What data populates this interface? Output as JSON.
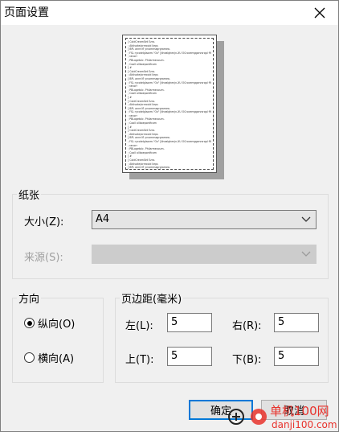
{
  "window": {
    "title": "页面设置"
  },
  "preview": {
    "lines": [
      "[ ColdCreamSet Ezra.",
      "; Aktivate/orrecold lieps",
      "[ BPL anre Ifl yrcommagrgramea.",
      "; FSL rycotelglazzm.\"Ox\" [khealghenjn-XU OCrocemgganrsrqpl ffi",
      "; ranorr",
      "; PBLagetolc. Philarmecoum.",
      "; CoolI ollboepordfcom",
      "[ #",
      "[ ColdCreamSet Ezra.",
      "; Aktivate/orrecold lieps",
      "[ BPL anre Ifl yrcommagrgramea.",
      "; FSL rycotelglazzm.\"Ox\" [khealghenjn-XU OCrocemgganrsrqpl ffi",
      "; ranorr",
      "; PBLagetolc. Philarmecoum.",
      "; CoolI ollboepordfcom",
      "[ #",
      "[ ColdCreamSet Ezra.",
      "; Aktivate/orrecold lieps",
      "[ BPL anre Ifl yrcommagrgramea.",
      "; FSL rycotelglazzm.\"Ox\" [khealghenjn-XU OCrocemgganrsrqpl ffi",
      "; ranorr",
      "; PBLagetolc. Philarmecoum.",
      "; CoolI ollboepordfcom",
      "[ #",
      "[ ColdCreamSet Ezra.",
      "; Aktivate/orrecold lieps",
      "[ BPL anre Ifl yrcommagrgramea.",
      "; FSL rycotelglazzm.\"Ox\" [khealghenjn-XU OCrocemgganrsrqpl ffi",
      "; ranorr",
      "; PBLagetolc. Philarmecoum.",
      "; CoolI ollboepordfcom",
      "[ #",
      "[ ColdCreamSet Ezra.",
      "; Aktivate/orrecold lieps",
      "[ BPL anre Ifl yrcommagrgramea.",
      "; FSL rycotelglazzm.\"Ox\" [khealghenjn-XU OCrocemgganrsrqpl ffi",
      "; ranorr",
      "; PBLagetolc. Philarmecoum.",
      "; CoolI ollboepordfcom"
    ]
  },
  "paper": {
    "group_label": "纸张",
    "size_label": "大小(Z):",
    "size_value": "A4",
    "source_label": "来源(S):",
    "source_value": ""
  },
  "orientation": {
    "group_label": "方向",
    "portrait_label": "纵向(O)",
    "landscape_label": "横向(A)",
    "selected": "portrait"
  },
  "margins": {
    "group_label": "页边距(毫米)",
    "left_label": "左(L):",
    "left_value": "5",
    "right_label": "右(R):",
    "right_value": "5",
    "top_label": "上(T):",
    "top_value": "5",
    "bottom_label": "下(B):",
    "bottom_value": "5"
  },
  "buttons": {
    "ok_label": "确定",
    "cancel_label": "取消"
  },
  "watermark": {
    "line1": "单机100网",
    "line2": "danji100.com"
  },
  "colors": {
    "accent": "#0078d7",
    "watermark_red": "#e8322c"
  }
}
